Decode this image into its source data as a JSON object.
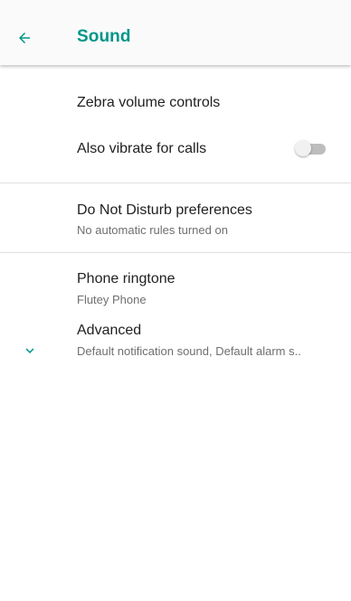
{
  "app_bar": {
    "title": "Sound",
    "back_icon": "arrow-back-icon",
    "accent_color": "#009688"
  },
  "items": [
    {
      "title": "Zebra volume controls"
    },
    {
      "title": "Also vibrate for calls",
      "toggle": "off"
    },
    {
      "title": "Do Not Disturb preferences",
      "summary": "No automatic rules turned on"
    },
    {
      "title": "Phone ringtone",
      "summary": "Flutey Phone"
    },
    {
      "title": "Advanced",
      "summary": "Default notification sound, Default alarm s..",
      "icon": "chevron-down-icon"
    }
  ]
}
